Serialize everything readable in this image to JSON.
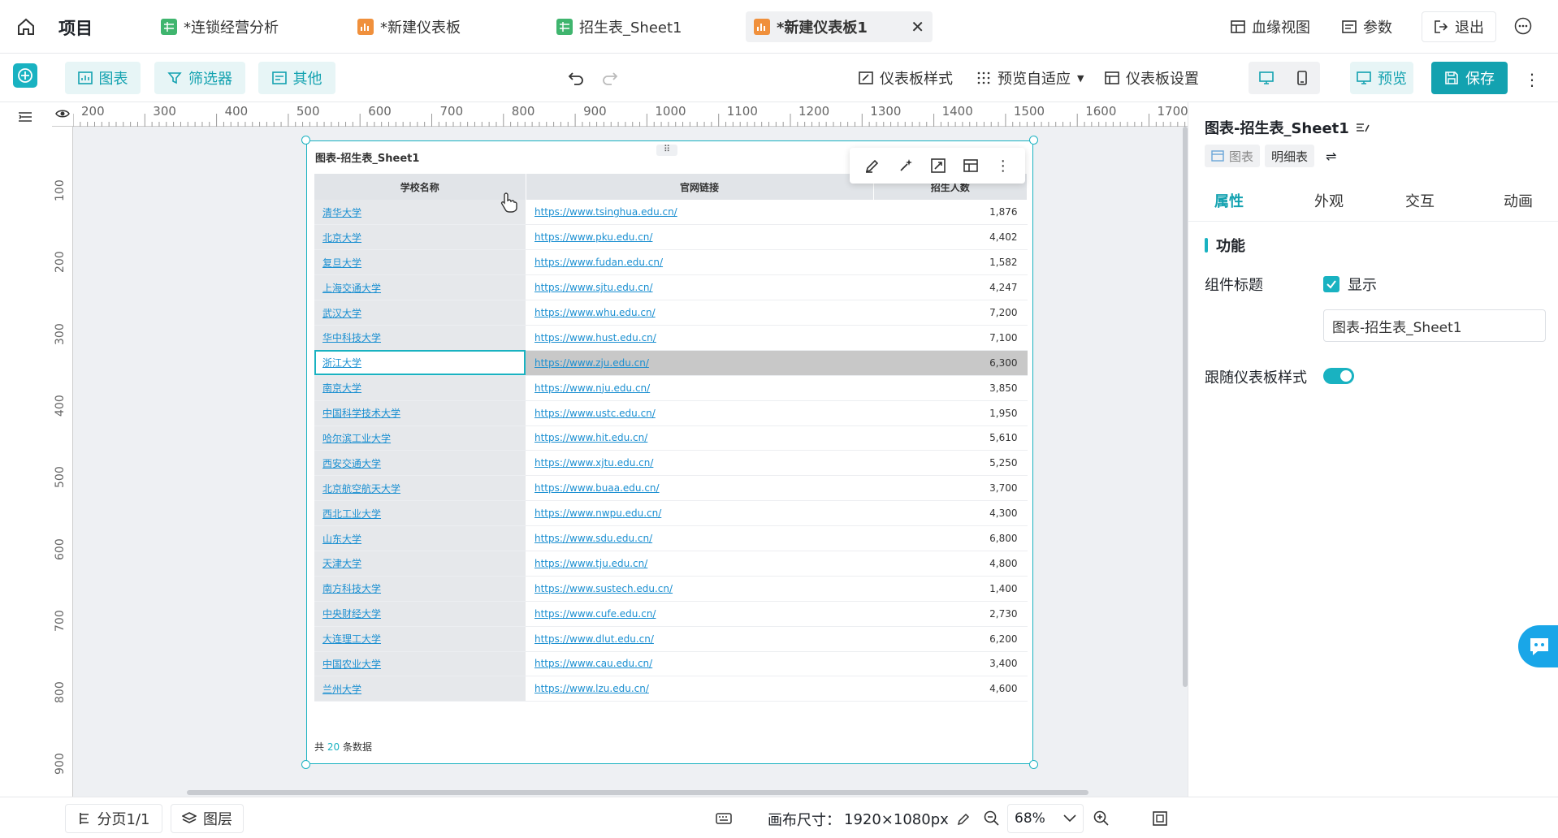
{
  "topbar": {
    "project_label": "项目",
    "tabs": [
      {
        "label": "*连锁经营分析",
        "icon": "sheet-icon"
      },
      {
        "label": "*新建仪表板",
        "icon": "dashboard-icon"
      },
      {
        "label": "招生表_Sheet1",
        "icon": "sheet-icon"
      },
      {
        "label": "*新建仪表板1",
        "icon": "dashboard-icon",
        "active": true
      }
    ],
    "lineage_label": "血缘视图",
    "params_label": "参数",
    "exit_label": "退出"
  },
  "toolbar": {
    "chart_label": "图表",
    "filter_label": "筛选器",
    "other_label": "其他",
    "dashboard_style_label": "仪表板样式",
    "preview_fit_label": "预览自适应",
    "dashboard_settings_label": "仪表板设置",
    "preview_label": "预览",
    "save_label": "保存"
  },
  "ruler": {
    "top_ticks": [
      "200",
      "300",
      "400",
      "500",
      "600",
      "700",
      "800",
      "900",
      "1000",
      "1100",
      "1200",
      "1300",
      "1400",
      "1500",
      "1600",
      "1700"
    ],
    "left_ticks": [
      "100",
      "200",
      "300",
      "400",
      "500",
      "600",
      "700",
      "800",
      "900"
    ]
  },
  "widget": {
    "title": "图表-招生表_Sheet1",
    "columns": [
      "学校名称",
      "官网链接",
      "招生人数"
    ],
    "rows": [
      [
        "清华大学",
        "https://www.tsinghua.edu.cn/",
        "1,876"
      ],
      [
        "北京大学",
        "https://www.pku.edu.cn/",
        "4,402"
      ],
      [
        "复旦大学",
        "https://www.fudan.edu.cn/",
        "1,582"
      ],
      [
        "上海交通大学",
        "https://www.sjtu.edu.cn/",
        "4,247"
      ],
      [
        "武汉大学",
        "https://www.whu.edu.cn/",
        "7,200"
      ],
      [
        "华中科技大学",
        "https://www.hust.edu.cn/",
        "7,100"
      ],
      [
        "浙江大学",
        "https://www.zju.edu.cn/",
        "6,300"
      ],
      [
        "南京大学",
        "https://www.nju.edu.cn/",
        "3,850"
      ],
      [
        "中国科学技术大学",
        "https://www.ustc.edu.cn/",
        "1,950"
      ],
      [
        "哈尔滨工业大学",
        "https://www.hit.edu.cn/",
        "5,610"
      ],
      [
        "西安交通大学",
        "https://www.xjtu.edu.cn/",
        "5,250"
      ],
      [
        "北京航空航天大学",
        "https://www.buaa.edu.cn/",
        "3,700"
      ],
      [
        "西北工业大学",
        "https://www.nwpu.edu.cn/",
        "4,300"
      ],
      [
        "山东大学",
        "https://www.sdu.edu.cn/",
        "6,800"
      ],
      [
        "天津大学",
        "https://www.tju.edu.cn/",
        "4,800"
      ],
      [
        "南方科技大学",
        "https://www.sustech.edu.cn/",
        "1,400"
      ],
      [
        "中央财经大学",
        "https://www.cufe.edu.cn/",
        "2,730"
      ],
      [
        "大连理工大学",
        "https://www.dlut.edu.cn/",
        "6,200"
      ],
      [
        "中国农业大学",
        "https://www.cau.edu.cn/",
        "3,400"
      ],
      [
        "兰州大学",
        "https://www.lzu.edu.cn/",
        "4,600"
      ]
    ],
    "selected_row": 6,
    "footer_prefix": "共",
    "footer_count": "20",
    "footer_suffix": "条数据"
  },
  "panel": {
    "title": "图表-招生表_Sheet1",
    "mode_chart": "图表",
    "mode_detail": "明细表",
    "tabs": [
      "属性",
      "外观",
      "交互",
      "动画"
    ],
    "section": "功能",
    "component_title_label": "组件标题",
    "show_label": "显示",
    "title_input_value": "图表-招生表_Sheet1",
    "follow_style_label": "跟随仪表板样式"
  },
  "bottombar": {
    "page_label": "分页1/1",
    "layer_label": "图层",
    "canvas_size_label": "画布尺寸：",
    "canvas_size_value": "1920×1080px",
    "zoom": "68%"
  },
  "colors": {
    "accent": "#19b2c1",
    "link": "#1a8fd1",
    "save_bg": "#13a2b0"
  }
}
